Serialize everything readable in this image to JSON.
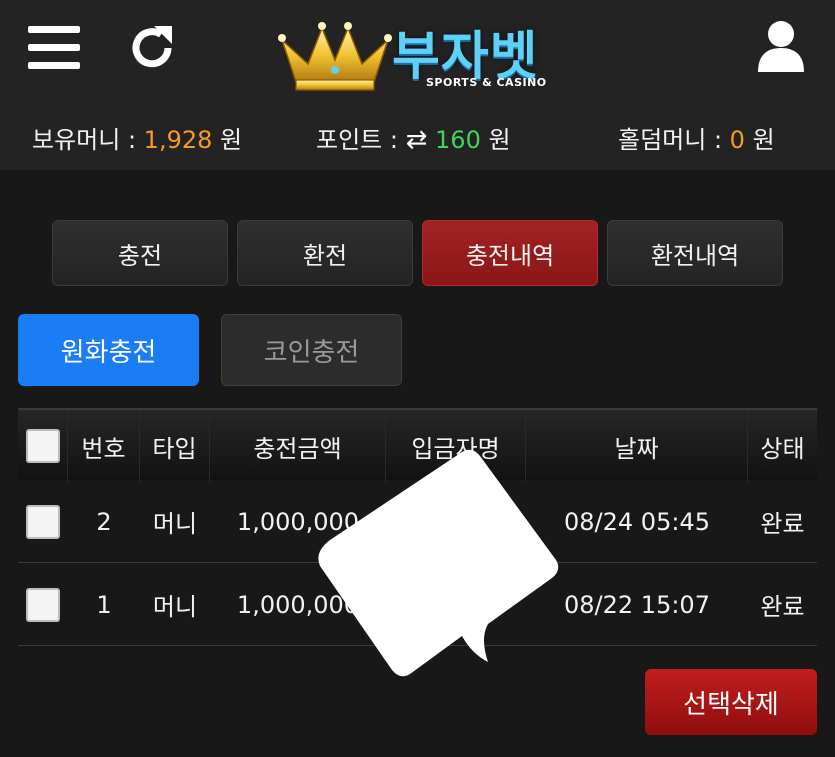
{
  "header": {
    "logo": {
      "title": "부자벳",
      "subtitle": "SPORTS & CASINO"
    },
    "icons": {
      "menu": "hamburger-menu-icon",
      "refresh": "refresh-icon",
      "user": "user-icon",
      "logo": "crown-icon"
    }
  },
  "balances": {
    "money": {
      "label": "보유머니 : ",
      "value": "1,928",
      "unit": " 원"
    },
    "point": {
      "label": "포인트 : ",
      "icon": "⇄",
      "value": "160",
      "unit": " 원"
    },
    "holdem": {
      "label": "홀덤머니 : ",
      "value": "0",
      "unit": " 원"
    },
    "colors": {
      "money": "#f59a23",
      "point": "#41d35a",
      "holdem": "#f59a23"
    }
  },
  "tabs": [
    {
      "label": "충전",
      "active": false
    },
    {
      "label": "환전",
      "active": false
    },
    {
      "label": "충전내역",
      "active": true
    },
    {
      "label": "환전내역",
      "active": false
    }
  ],
  "sub_tabs": [
    {
      "label": "원화충전",
      "active": true
    },
    {
      "label": "코인충전",
      "active": false
    }
  ],
  "table": {
    "headers": [
      "번호",
      "타입",
      "충전금액",
      "입금자명",
      "날짜",
      "상태"
    ],
    "rows": [
      {
        "no": "2",
        "type": "머니",
        "amount": "1,000,000",
        "depositor": "",
        "date": "08/24 05:45",
        "status": "완료"
      },
      {
        "no": "1",
        "type": "머니",
        "amount": "1,000,000",
        "depositor": "",
        "date": "08/22 15:07",
        "status": "완료"
      }
    ]
  },
  "actions": {
    "delete_selected": "선택삭제"
  },
  "colors": {
    "accent_blue": "#1a7df3",
    "active_red": "#a32323",
    "delete_red": "#c21d1d"
  }
}
